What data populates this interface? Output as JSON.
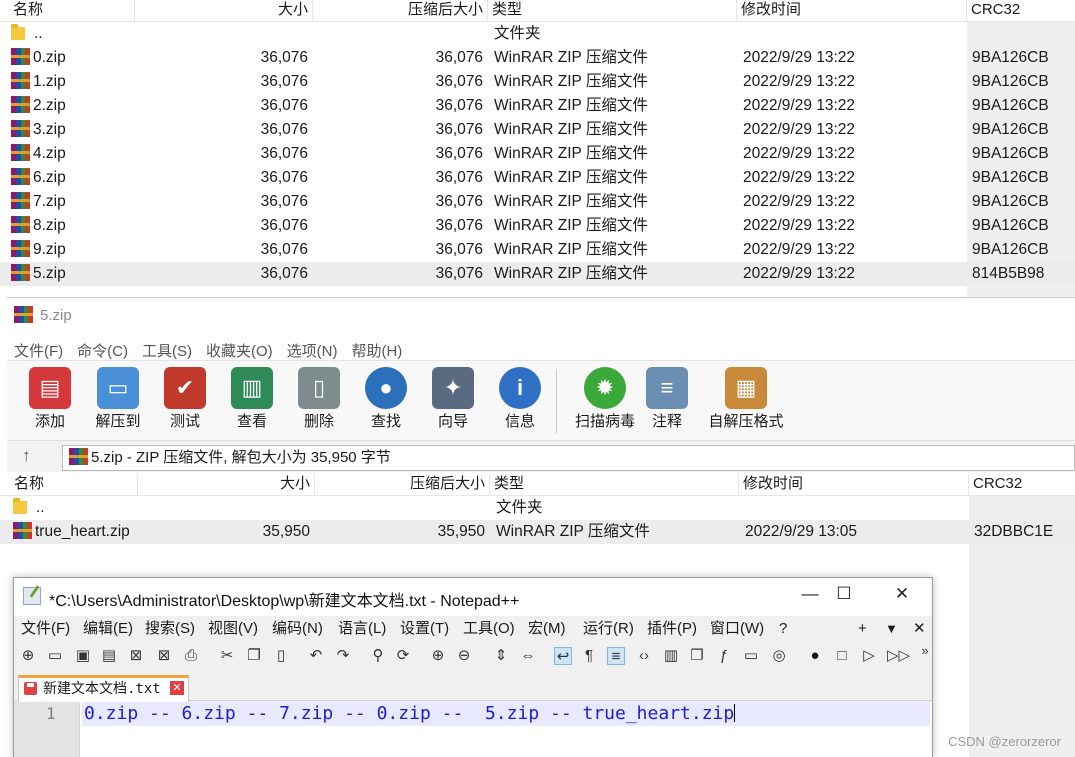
{
  "top_list": {
    "headers": {
      "name": "名称",
      "size": "大小",
      "packed": "压缩后大小",
      "type": "类型",
      "modified": "修改时间",
      "crc": "CRC32"
    },
    "rows": [
      {
        "name": "..",
        "size": "",
        "packed": "",
        "type": "文件夹",
        "modified": "",
        "crc": "",
        "kind": "folder"
      },
      {
        "name": "0.zip",
        "size": "36,076",
        "packed": "36,076",
        "type": "WinRAR ZIP 压缩文件",
        "modified": "2022/9/29 13:22",
        "crc": "9BA126CB",
        "kind": "zip"
      },
      {
        "name": "1.zip",
        "size": "36,076",
        "packed": "36,076",
        "type": "WinRAR ZIP 压缩文件",
        "modified": "2022/9/29 13:22",
        "crc": "9BA126CB",
        "kind": "zip"
      },
      {
        "name": "2.zip",
        "size": "36,076",
        "packed": "36,076",
        "type": "WinRAR ZIP 压缩文件",
        "modified": "2022/9/29 13:22",
        "crc": "9BA126CB",
        "kind": "zip"
      },
      {
        "name": "3.zip",
        "size": "36,076",
        "packed": "36,076",
        "type": "WinRAR ZIP 压缩文件",
        "modified": "2022/9/29 13:22",
        "crc": "9BA126CB",
        "kind": "zip"
      },
      {
        "name": "4.zip",
        "size": "36,076",
        "packed": "36,076",
        "type": "WinRAR ZIP 压缩文件",
        "modified": "2022/9/29 13:22",
        "crc": "9BA126CB",
        "kind": "zip"
      },
      {
        "name": "6.zip",
        "size": "36,076",
        "packed": "36,076",
        "type": "WinRAR ZIP 压缩文件",
        "modified": "2022/9/29 13:22",
        "crc": "9BA126CB",
        "kind": "zip"
      },
      {
        "name": "7.zip",
        "size": "36,076",
        "packed": "36,076",
        "type": "WinRAR ZIP 压缩文件",
        "modified": "2022/9/29 13:22",
        "crc": "9BA126CB",
        "kind": "zip"
      },
      {
        "name": "8.zip",
        "size": "36,076",
        "packed": "36,076",
        "type": "WinRAR ZIP 压缩文件",
        "modified": "2022/9/29 13:22",
        "crc": "9BA126CB",
        "kind": "zip"
      },
      {
        "name": "9.zip",
        "size": "36,076",
        "packed": "36,076",
        "type": "WinRAR ZIP 压缩文件",
        "modified": "2022/9/29 13:22",
        "crc": "9BA126CB",
        "kind": "zip"
      },
      {
        "name": "5.zip",
        "size": "36,076",
        "packed": "36,076",
        "type": "WinRAR ZIP 压缩文件",
        "modified": "2022/9/29 13:22",
        "crc": "814B5B98",
        "kind": "zip",
        "selected": true
      }
    ]
  },
  "winrar": {
    "title": "5.zip",
    "menu": [
      "文件(F)",
      "命令(C)",
      "工具(S)",
      "收藏夹(O)",
      "选项(N)",
      "帮助(H)"
    ],
    "toolbar": [
      {
        "label": "添加",
        "icon": "add-archive-icon",
        "color": "#d4383a"
      },
      {
        "label": "解压到",
        "icon": "extract-folder-icon",
        "color": "#4a90d9"
      },
      {
        "label": "测试",
        "icon": "test-clipboard-icon",
        "color": "#c0392b"
      },
      {
        "label": "查看",
        "icon": "view-book-icon",
        "color": "#2e8b57"
      },
      {
        "label": "删除",
        "icon": "trash-icon",
        "color": "#7f8c8d"
      },
      {
        "label": "查找",
        "icon": "magnifier-icon",
        "color": "#2c6fbb"
      },
      {
        "label": "向导",
        "icon": "magic-wand-icon",
        "color": "#5a6a80"
      },
      {
        "label": "信息",
        "icon": "info-icon",
        "color": "#2f6fc4"
      },
      {
        "label": "扫描病毒",
        "icon": "virus-scan-icon",
        "color": "#3aa83a"
      },
      {
        "label": "注释",
        "icon": "comment-icon",
        "color": "#6b8fb3"
      },
      {
        "label": "自解压格式",
        "icon": "sfx-box-icon",
        "color": "#c8893a"
      }
    ],
    "address": "5.zip - ZIP 压缩文件, 解包大小为 35,950 字节"
  },
  "inner_list": {
    "headers": {
      "name": "名称",
      "size": "大小",
      "packed": "压缩后大小",
      "type": "类型",
      "modified": "修改时间",
      "crc": "CRC32"
    },
    "rows": [
      {
        "name": "..",
        "size": "",
        "packed": "",
        "type": "文件夹",
        "modified": "",
        "crc": "",
        "kind": "folder"
      },
      {
        "name": "true_heart.zip",
        "size": "35,950",
        "packed": "35,950",
        "type": "WinRAR ZIP 压缩文件",
        "modified": "2022/9/29 13:05",
        "crc": "32DBBC1E",
        "kind": "zip",
        "selected": true
      }
    ]
  },
  "notepad": {
    "title": "*C:\\Users\\Administrator\\Desktop\\wp\\新建文本文档.txt - Notepad++",
    "window_controls": {
      "minimize": "—",
      "maximize": "☐",
      "close": "✕"
    },
    "menu": [
      "文件(F)",
      "编辑(E)",
      "搜索(S)",
      "视图(V)",
      "编码(N)",
      "语言(L)",
      "设置(T)",
      "工具(O)",
      "宏(M)",
      "运行(R)",
      "插件(P)",
      "窗口(W)",
      "?"
    ],
    "menu_right": {
      "plus": "+",
      "down": "▼",
      "close": "✕"
    },
    "tab": "新建文本文档.txt",
    "line_number": "1",
    "line_text": "0.zip -- 6.zip -- 7.zip -- 0.zip --  5.zip -- true_heart.zip"
  },
  "watermark": "CSDN @zerorzeror"
}
